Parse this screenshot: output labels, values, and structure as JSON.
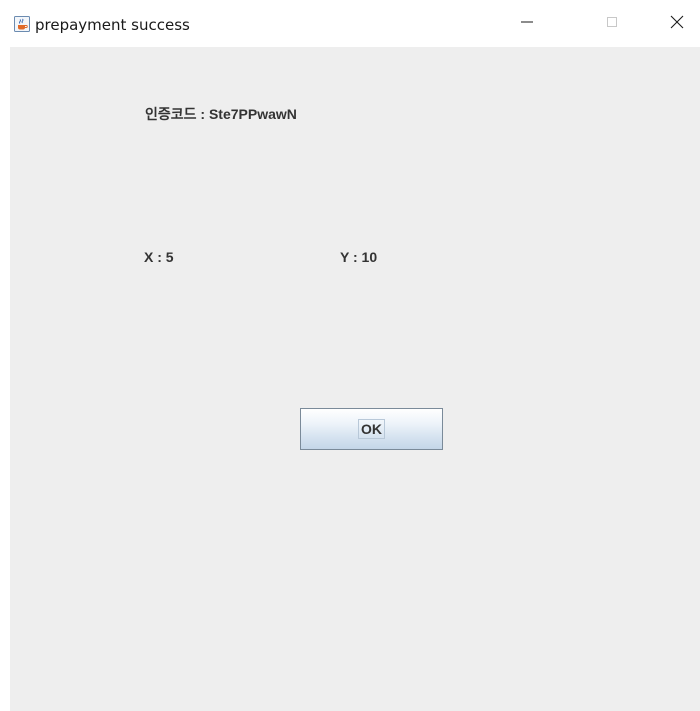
{
  "window": {
    "title": "prepayment success",
    "app_icon": "java-cup-icon",
    "controls": {
      "minimize": "minimize-icon",
      "maximize": "maximize-icon",
      "close": "close-icon"
    }
  },
  "content": {
    "auth_code_label": "인증코드 : Ste7PPwawN",
    "x_label": "X : 5",
    "y_label": "Y : 10",
    "ok_button_label": "OK"
  },
  "colors": {
    "background": "#eeeeee",
    "text": "#333333",
    "button_border": "#7a8a99"
  }
}
